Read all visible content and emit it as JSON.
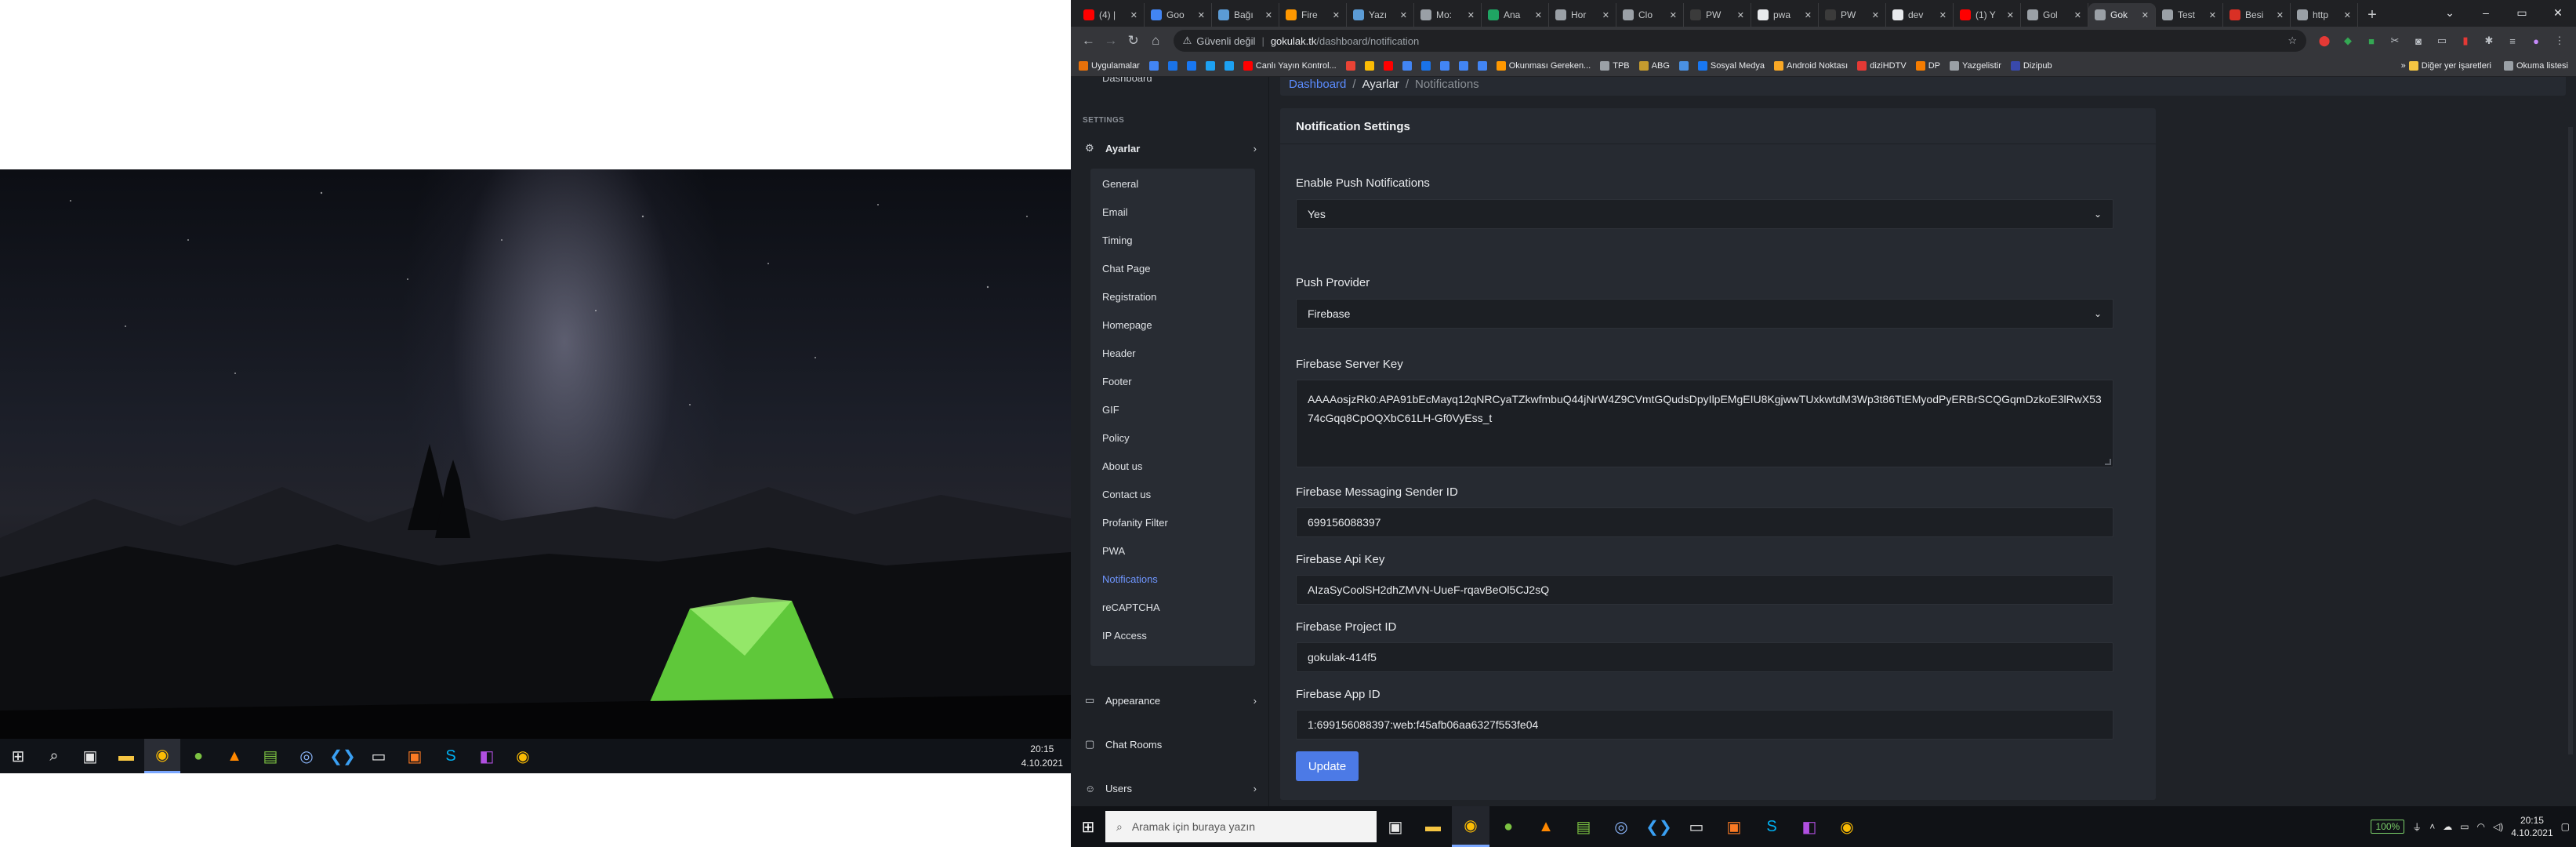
{
  "left_screen": {
    "taskbar_apps": [
      "windows-start-icon",
      "search-icon",
      "task-view-icon",
      "file-explorer-icon",
      "chrome-icon",
      "android-app-icon",
      "vlc-icon",
      "notepad-icon",
      "obs-icon",
      "vscode-icon",
      "terminal-icon",
      "xampp-icon",
      "skype-icon",
      "app-icon",
      "chrome-icon"
    ],
    "clock_time": "20:15",
    "clock_date": "4.10.2021"
  },
  "browser": {
    "tabs": [
      {
        "icon": "youtube-icon",
        "title": "(4) |",
        "color": "#ff0000"
      },
      {
        "icon": "google-docs-icon",
        "title": "Goo",
        "color": "#4285f4"
      },
      {
        "icon": "wordpress-icon",
        "title": "Bağı",
        "color": "#5b9bd5"
      },
      {
        "icon": "firebase-icon",
        "title": "Fire",
        "color": "#ff9800"
      },
      {
        "icon": "wordpress-icon",
        "title": "Yazı",
        "color": "#5b9bd5"
      },
      {
        "icon": "globe-icon",
        "title": "Mo:",
        "color": "#9aa0a6"
      },
      {
        "icon": "drive-icon",
        "title": "Ana",
        "color": "#1fa463"
      },
      {
        "icon": "globe-icon",
        "title": "Hor",
        "color": "#9aa0a6"
      },
      {
        "icon": "page-icon",
        "title": "Clo",
        "color": "#9aa0a6"
      },
      {
        "icon": "pwa-icon",
        "title": "PW",
        "color": "#3b3b3b"
      },
      {
        "icon": "github-icon",
        "title": "pwa",
        "color": "#e8eaed"
      },
      {
        "icon": "pwa-icon",
        "title": "PW",
        "color": "#3b3b3b"
      },
      {
        "icon": "github-icon",
        "title": "dev",
        "color": "#e8eaed"
      },
      {
        "icon": "youtube-icon",
        "title": "(1) Y",
        "color": "#ff0000"
      },
      {
        "icon": "globe-icon",
        "title": "Gol",
        "color": "#9aa0a6"
      },
      {
        "icon": "globe-icon",
        "title": "Gok",
        "color": "#9aa0a6",
        "active": true
      },
      {
        "icon": "globe-icon",
        "title": "Test",
        "color": "#9aa0a6"
      },
      {
        "icon": "besic-icon",
        "title": "Besi",
        "color": "#d93025"
      },
      {
        "icon": "globe-icon",
        "title": "http",
        "color": "#9aa0a6"
      }
    ],
    "address": {
      "security_label": "Güvenli değil",
      "host": "gokulak.tk",
      "path": "/dashboard/notification"
    },
    "bookmarks": [
      {
        "label": "Uygulamalar",
        "color": "#e8710a"
      },
      {
        "label": "",
        "color": "#4285f4"
      },
      {
        "label": "",
        "color": "#1a73e8"
      },
      {
        "label": "",
        "color": "#1877f2"
      },
      {
        "label": "",
        "color": "#1da1f2"
      },
      {
        "label": "",
        "color": "#1da1f2"
      },
      {
        "label": "Canlı Yayın Kontrol...",
        "color": "#ff0000"
      },
      {
        "label": "",
        "color": "#ea4335"
      },
      {
        "label": "",
        "color": "#fbbc04"
      },
      {
        "label": "",
        "color": "#ff0000"
      },
      {
        "label": "",
        "color": "#4285f4"
      },
      {
        "label": "",
        "color": "#1a73e8"
      },
      {
        "label": "",
        "color": "#4285f4"
      },
      {
        "label": "",
        "color": "#4285f4"
      },
      {
        "label": "",
        "color": "#4285f4"
      },
      {
        "label": "Okunması Gereken...",
        "color": "#ff9800"
      },
      {
        "label": "TPB",
        "color": "#9aa0a6"
      },
      {
        "label": "ABG",
        "color": "#c59b2e"
      },
      {
        "label": "",
        "color": "#4a90e2"
      },
      {
        "label": "Sosyal Medya",
        "color": "#1877f2"
      },
      {
        "label": "Android Noktası",
        "color": "#f9a825"
      },
      {
        "label": "diziHDTV",
        "color": "#e53935"
      },
      {
        "label": "DP",
        "color": "#f57c00"
      },
      {
        "label": "Yazgelistir",
        "color": "#9aa0a6"
      },
      {
        "label": "Dizipub",
        "color": "#3949ab"
      }
    ],
    "bookmarks_right": [
      "Diğer yer işaretleri",
      "Okuma listesi"
    ]
  },
  "sidebar": {
    "cut_item": "Dashboard",
    "section": "SETTINGS",
    "settings_menu": "Ayarlar",
    "sub_items": [
      "General",
      "Email",
      "Timing",
      "Chat Page",
      "Registration",
      "Homepage",
      "Header",
      "Footer",
      "GIF",
      "Policy",
      "About us",
      "Contact us",
      "Profanity Filter",
      "PWA",
      "Notifications",
      "reCAPTCHA",
      "IP Access"
    ],
    "active_sub": "Notifications",
    "other_menus": [
      "Appearance",
      "Chat Rooms",
      "Users"
    ]
  },
  "breadcrumb": {
    "items": [
      "Dashboard",
      "Ayarlar",
      "Notifications"
    ]
  },
  "form": {
    "title": "Notification Settings",
    "enable_push_label": "Enable Push Notifications",
    "enable_push_value": "Yes",
    "push_provider_label": "Push Provider",
    "push_provider_value": "Firebase",
    "server_key_label": "Firebase Server Key",
    "server_key_value": "AAAAosjzRk0:APA91bEcMayq12qNRCyaTZkwfmbuQ44jNrW4Z9CVmtGQudsDpyIlpEMgEIU8KgjwwTUxkwtdM3Wp3t86TtEMyodPyERBrSCQGqmDzkoE3lRwX5374cGqq8CpOQXbC61LH-Gf0VyEss_t",
    "sender_id_label": "Firebase Messaging Sender ID",
    "sender_id_value": "699156088397",
    "api_key_label": "Firebase Api Key",
    "api_key_value": "AIzaSyCoolSH2dhZMVN-UueF-rqavBeOl5CJ2sQ",
    "project_id_label": "Firebase Project ID",
    "project_id_value": "gokulak-414f5",
    "app_id_label": "Firebase App ID",
    "app_id_value": "1:699156088397:web:f45afb06aa6327f553fe04",
    "update_label": "Update"
  },
  "right_taskbar": {
    "search_placeholder": "Aramak için buraya yazın",
    "zoom": "100%",
    "clock_time": "20:15",
    "clock_date": "4.10.2021"
  }
}
